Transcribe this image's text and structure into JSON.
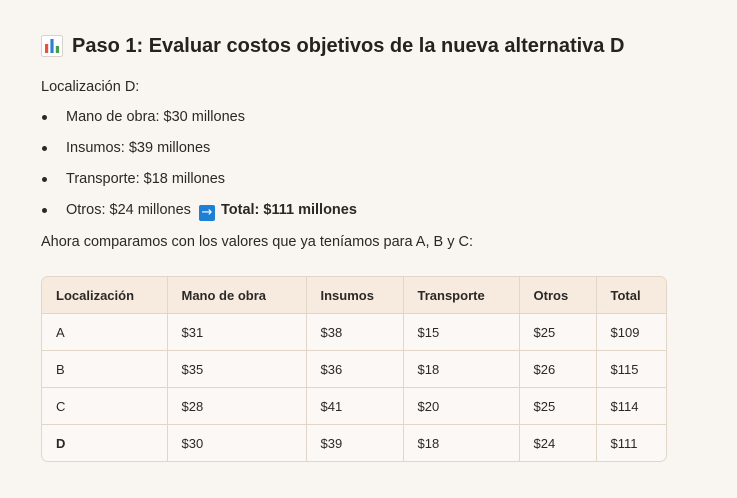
{
  "heading": {
    "icon": "bar-chart-icon",
    "text": "Paso 1: Evaluar costos objetivos de la nueva alternativa D"
  },
  "intro": "Localización D:",
  "items": [
    "Mano de obra: $30 millones",
    "Insumos: $39 millones",
    "Transporte: $18 millones",
    "Otros: $24 millones"
  ],
  "arrow_icon": "right-arrow-icon",
  "total_text": "Total: $111 millones",
  "compare_text": "Ahora comparamos con los valores que ya teníamos para A, B y C:",
  "table": {
    "headers": [
      "Localización",
      "Mano de obra",
      "Insumos",
      "Transporte",
      "Otros",
      "Total"
    ],
    "rows": [
      [
        "A",
        "$31",
        "$38",
        "$15",
        "$25",
        "$109"
      ],
      [
        "B",
        "$35",
        "$36",
        "$18",
        "$26",
        "$115"
      ],
      [
        "C",
        "$28",
        "$41",
        "$20",
        "$25",
        "$114"
      ],
      [
        "D",
        "$30",
        "$39",
        "$18",
        "$24",
        "$111"
      ]
    ],
    "bold_row_labels": [
      "D"
    ]
  },
  "colors": {
    "background": "#f9f5f1",
    "header_bg": "#f7ebe0",
    "border": "#e2d6c8",
    "icon_bar_red": "#e5533d",
    "icon_bar_blue": "#2f7fd8",
    "icon_bar_green": "#43a047",
    "arrow_bg": "#1e7fd6"
  }
}
